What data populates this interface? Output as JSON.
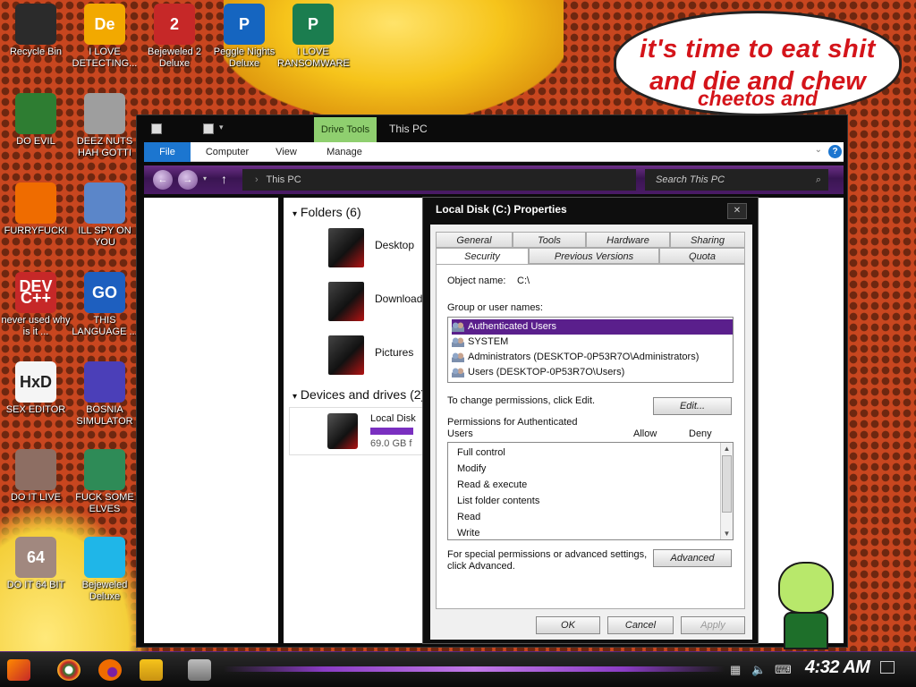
{
  "meme": {
    "line1": "it's time to eat shit",
    "line2": "and die and chew",
    "line3": "cheetos and"
  },
  "desktop_icons": [
    {
      "label": "Recycle Bin",
      "icon": "recycle-bin-icon",
      "glyph": "",
      "color": "#2b2b2b"
    },
    {
      "label": "I LOVE DETECTING...",
      "icon": "detecting-app-icon",
      "glyph": "De",
      "color": "#f2a900"
    },
    {
      "label": "Bejeweled 2 Deluxe",
      "icon": "bejeweled2-icon",
      "glyph": "2",
      "color": "#c62828"
    },
    {
      "label": "Peggle Nights Deluxe",
      "icon": "peggle-icon",
      "glyph": "P",
      "color": "#1565c0"
    },
    {
      "label": "I LOVE RANSOMWARE",
      "icon": "ransomware-icon",
      "glyph": "P",
      "color": "#1b7d4f"
    },
    {
      "label": "DO EVIL",
      "icon": "chrome-icon",
      "glyph": "",
      "color": "#2e7d32"
    },
    {
      "label": "DEEZ NUTS HAH GOTTI",
      "icon": "windows-stack-icon",
      "glyph": "",
      "color": "#9e9e9e"
    },
    {
      "label": "FURRYFUCK!",
      "icon": "firefox-icon",
      "glyph": "",
      "color": "#ef6c00"
    },
    {
      "label": "ILL SPY ON YOU",
      "icon": "spy-magnifier-icon",
      "glyph": "",
      "color": "#5b86c9"
    },
    {
      "label": "never used why is it ...",
      "icon": "devcpp-icon",
      "glyph": "DEV C++",
      "color": "#c62828"
    },
    {
      "label": "THIS LANGUAGE ...",
      "icon": "golang-icon",
      "glyph": "GO",
      "color": "#1e5fbf"
    },
    {
      "label": "SEX EDITOR",
      "icon": "hxd-icon",
      "glyph": "HxD",
      "color": "#f5f5f5"
    },
    {
      "label": "BOSNIA SIMULATOR",
      "icon": "mine-icon",
      "glyph": "",
      "color": "#4b3fb8"
    },
    {
      "label": "DO IT LIVE",
      "icon": "portrait-icon",
      "glyph": "",
      "color": "#8d6e63"
    },
    {
      "label": "FUCK SOME ELVES",
      "icon": "santa-icon",
      "glyph": "",
      "color": "#2e8b57"
    },
    {
      "label": "DO IT 64 BIT",
      "icon": "portrait-64-icon",
      "glyph": "64",
      "color": "#a1887f"
    },
    {
      "label": "Bejeweled Deluxe",
      "icon": "diamond-icon",
      "glyph": "",
      "color": "#1fb6e8"
    }
  ],
  "explorer": {
    "drive_tools": "Drive Tools",
    "title": "This PC",
    "tabs": [
      "File",
      "Computer",
      "View",
      "Manage"
    ],
    "address": "This PC",
    "search_placeholder": "Search This PC",
    "folders_header": "Folders (6)",
    "folders": [
      "Desktop",
      "Downloads",
      "Pictures"
    ],
    "devices_header": "Devices and drives (2)",
    "drive": {
      "name": "Local Disk",
      "free": "69.0 GB f",
      "fill_fraction": 0.45
    }
  },
  "dialog": {
    "title": "Local Disk (C:) Properties",
    "tabs_row1": [
      "General",
      "Tools",
      "Hardware",
      "Sharing"
    ],
    "tabs_row2": [
      "Security",
      "Previous Versions",
      "Quota"
    ],
    "active_tab": "Security",
    "object_name_label": "Object name:",
    "object_name_value": "C:\\",
    "group_label": "Group or user names:",
    "users": [
      "Authenticated Users",
      "SYSTEM",
      "Administrators (DESKTOP-0P53R7O\\Administrators)",
      "Users (DESKTOP-0P53R7O\\Users)"
    ],
    "change_perm_text": "To change permissions, click Edit.",
    "edit_button": "Edit...",
    "perm_for_line1": "Permissions for Authenticated",
    "perm_for_line2": "Users",
    "allow_label": "Allow",
    "deny_label": "Deny",
    "permissions": [
      "Full control",
      "Modify",
      "Read & execute",
      "List folder contents",
      "Read",
      "Write"
    ],
    "special_line1": "For special permissions or advanced settings,",
    "special_line2": "click Advanced.",
    "advanced_button": "Advanced",
    "ok_button": "OK",
    "cancel_button": "Cancel",
    "apply_button": "Apply"
  },
  "taskbar": {
    "clock": "4:32 AM"
  }
}
